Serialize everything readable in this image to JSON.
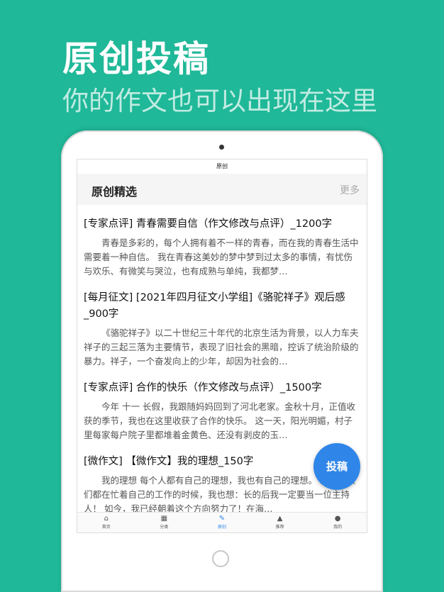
{
  "promo": {
    "title": "原创投稿",
    "subtitle": "你的作文也可以出现在这里"
  },
  "status_bar": {
    "title": "原创"
  },
  "section": {
    "title": "原创精选",
    "more": "更多"
  },
  "articles": [
    {
      "title": "[专家点评] 青春需要自信（作文修改与点评）_1200字",
      "snippet": "青春是多彩的，每个人拥有着不一样的青春，而在我的青春生活中需要着一种自信。 我在青春这美妙的梦中梦到过太多的事情，有忧伤与欢乐、有微笑与哭泣，也有成熟与单纯，我都梦…"
    },
    {
      "title": "[每月征文] [2021年四月征文小学组]《骆驼祥子》观后感_900字",
      "snippet": "《骆驼祥子》以二十世纪三十年代的北京生活为背景，以人力车夫祥子的三起三落为主要情节，表现了旧社会的黑暗，控诉了统治阶级的暴力。祥子，一个奋发向上的少年，却因为社会的…"
    },
    {
      "title": "[专家点评] 合作的快乐（作文修改与点评）_1500字",
      "snippet": "今年 十一 长假，我跟随妈妈回到了河北老家。金秋十月，正值收获的季节，我也在这里收获了合作的快乐。 这一天，阳光明媚，村子里每家每户院子里都堆着金黄色、还没有剥皮的玉…"
    },
    {
      "title": "[微作文] 【微作文】我的理想_150字",
      "snippet": "我的理想 每个人都有自己的理想，我也有自己的理想。 我见大人们都在忙着自己的工作的时候，我也想：长的后我一定要当一位主持人！ 如今，我已经朝着这个方向努力了！在海…"
    }
  ],
  "fab": {
    "label": "投稿"
  },
  "tabs": [
    {
      "label": "首页",
      "icon": "home-icon"
    },
    {
      "label": "分类",
      "icon": "grid-icon"
    },
    {
      "label": "原创",
      "icon": "pencil-icon"
    },
    {
      "label": "推荐",
      "icon": "thumbs-up-icon"
    },
    {
      "label": "我的",
      "icon": "user-icon"
    }
  ],
  "colors": {
    "background": "#1fb898",
    "accent": "#2f86e8"
  }
}
